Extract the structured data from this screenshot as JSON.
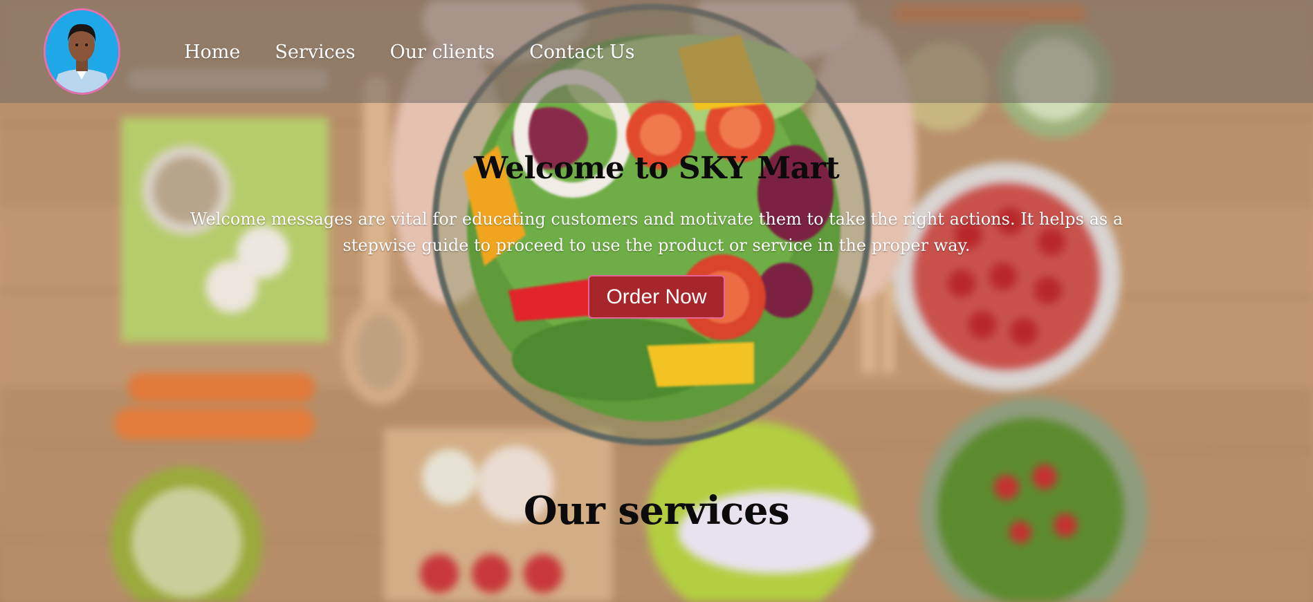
{
  "nav": {
    "avatar_alt": "profile photo",
    "links": [
      {
        "label": "Home"
      },
      {
        "label": "Services"
      },
      {
        "label": "Our clients"
      },
      {
        "label": "Contact Us"
      }
    ]
  },
  "hero": {
    "title": "Welcome to SKY Mart",
    "text": "Welcome messages are vital for educating customers and motivate them to take the right actions. It helps as a stepwise guide to proceed to use the product or service in the proper way.",
    "button_label": "Order Now",
    "background_image": "salad bowl held in hands over kitchen table with vegetables"
  },
  "services": {
    "title": "Our services"
  },
  "colors": {
    "navbar": "#736964",
    "button": "#a6262b",
    "button_border": "#e5659b",
    "avatar_border": "#e66fae",
    "avatar_bg": "#1fa8e8"
  }
}
